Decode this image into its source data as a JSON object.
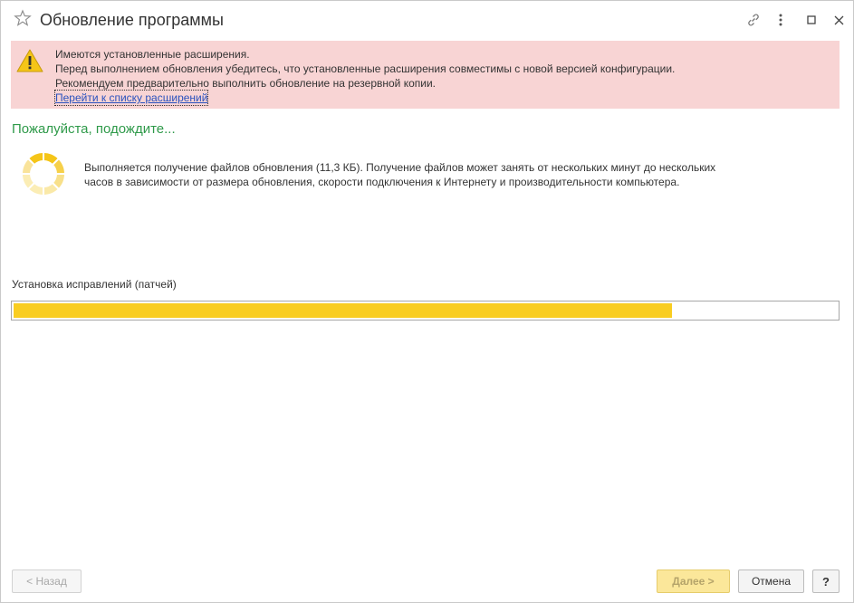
{
  "window": {
    "title": "Обновление программы"
  },
  "icons": {
    "favorite": "star-icon",
    "link": "link-icon",
    "more": "more-icon",
    "maximize": "maximize-icon",
    "close": "close-icon",
    "warning": "warning-icon",
    "spinner": "loading-spinner-icon"
  },
  "warning": {
    "line1": "Имеются установленные расширения.",
    "line2": "Перед выполнением обновления убедитесь, что установленные расширения совместимы с новой версией конфигурации.",
    "line3": "Рекомендуем предварительно выполнить обновление на резервной копии.",
    "link": "Перейти к списку расширений"
  },
  "status": {
    "title": "Пожалуйста, подождите...",
    "line1": "Выполняется получение файлов обновления (11,3 КБ). Получение файлов может занять от нескольких минут до нескольких",
    "line2": "часов в зависимости от размера обновления, скорости подключения к Интернету и производительности компьютера."
  },
  "install": {
    "label": "Установка исправлений (патчей)",
    "progress": 0.8
  },
  "footer": {
    "back": "< Назад",
    "next": "Далее >",
    "cancel": "Отмена",
    "help": "?"
  },
  "colors": {
    "accent_green": "#2f9a4a",
    "warning_bg": "#f8d4d4",
    "progress_fill": "#f9cd21",
    "link": "#2a52be"
  }
}
